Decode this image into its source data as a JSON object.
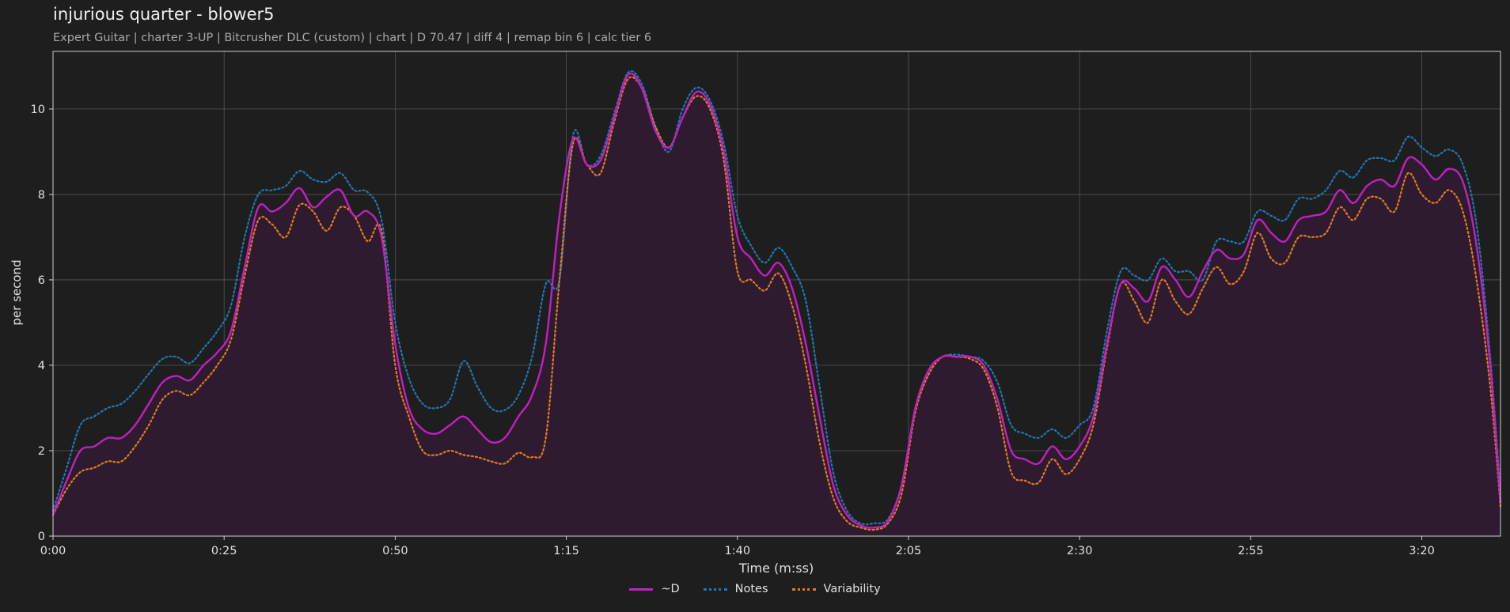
{
  "header": {
    "title": "injurious quarter - blower5",
    "subtitle": "Expert Guitar  |  charter 3-UP  |  Bitcrusher DLC (custom)  |  chart  |  D 70.47  |  diff 4  |  remap bin 6  |  calc tier 6"
  },
  "chart_data": {
    "type": "line",
    "xlabel": "Time (m:ss)",
    "ylabel": "per second",
    "xlim": [
      0,
      211.5
    ],
    "ylim": [
      0,
      11.35
    ],
    "x_ticks": [
      0,
      25,
      50,
      75,
      100,
      125,
      150,
      175,
      200
    ],
    "x_tick_labels": [
      "0:00",
      "0:25",
      "0:50",
      "1:15",
      "1:40",
      "2:05",
      "2:30",
      "2:55",
      "3:20"
    ],
    "y_ticks": [
      0,
      2,
      4,
      6,
      8,
      10
    ],
    "y_tick_labels": [
      "0",
      "2",
      "4",
      "6",
      "8",
      "10"
    ],
    "grid": true,
    "legend_position": "bottom-center",
    "series": [
      {
        "name": "~D",
        "color": "#c020c0",
        "dash": "solid",
        "fill": "#2f1b2f",
        "points": [
          [
            0,
            0.5
          ],
          [
            2,
            1.3
          ],
          [
            4,
            2.0
          ],
          [
            6,
            2.1
          ],
          [
            8,
            2.3
          ],
          [
            10,
            2.3
          ],
          [
            12,
            2.6
          ],
          [
            14,
            3.1
          ],
          [
            16,
            3.6
          ],
          [
            18,
            3.75
          ],
          [
            20,
            3.65
          ],
          [
            22,
            4.0
          ],
          [
            24,
            4.3
          ],
          [
            26,
            4.8
          ],
          [
            28,
            6.3
          ],
          [
            30,
            7.7
          ],
          [
            32,
            7.6
          ],
          [
            34,
            7.8
          ],
          [
            36,
            8.15
          ],
          [
            38,
            7.7
          ],
          [
            40,
            7.95
          ],
          [
            42,
            8.1
          ],
          [
            44,
            7.5
          ],
          [
            46,
            7.6
          ],
          [
            48,
            7.0
          ],
          [
            50,
            4.5
          ],
          [
            52,
            3.0
          ],
          [
            54,
            2.5
          ],
          [
            56,
            2.4
          ],
          [
            58,
            2.6
          ],
          [
            60,
            2.8
          ],
          [
            62,
            2.5
          ],
          [
            64,
            2.2
          ],
          [
            66,
            2.3
          ],
          [
            68,
            2.8
          ],
          [
            70,
            3.3
          ],
          [
            72,
            4.5
          ],
          [
            74,
            7.5
          ],
          [
            76,
            9.3
          ],
          [
            78,
            8.7
          ],
          [
            80,
            8.8
          ],
          [
            82,
            9.8
          ],
          [
            84,
            10.8
          ],
          [
            86,
            10.5
          ],
          [
            88,
            9.5
          ],
          [
            90,
            9.1
          ],
          [
            92,
            9.8
          ],
          [
            94,
            10.4
          ],
          [
            96,
            10.1
          ],
          [
            98,
            9.0
          ],
          [
            100,
            7.0
          ],
          [
            102,
            6.5
          ],
          [
            104,
            6.1
          ],
          [
            106,
            6.4
          ],
          [
            108,
            5.8
          ],
          [
            110,
            4.5
          ],
          [
            112,
            2.8
          ],
          [
            114,
            1.2
          ],
          [
            116,
            0.5
          ],
          [
            118,
            0.25
          ],
          [
            120,
            0.2
          ],
          [
            122,
            0.35
          ],
          [
            124,
            1.2
          ],
          [
            126,
            3.0
          ],
          [
            128,
            3.9
          ],
          [
            130,
            4.2
          ],
          [
            132,
            4.2
          ],
          [
            134,
            4.2
          ],
          [
            136,
            4.0
          ],
          [
            138,
            3.2
          ],
          [
            140,
            2.0
          ],
          [
            142,
            1.8
          ],
          [
            144,
            1.7
          ],
          [
            146,
            2.1
          ],
          [
            148,
            1.8
          ],
          [
            150,
            2.1
          ],
          [
            152,
            2.8
          ],
          [
            154,
            4.5
          ],
          [
            156,
            5.9
          ],
          [
            158,
            5.8
          ],
          [
            160,
            5.5
          ],
          [
            162,
            6.3
          ],
          [
            164,
            6.0
          ],
          [
            166,
            5.6
          ],
          [
            168,
            6.2
          ],
          [
            170,
            6.7
          ],
          [
            172,
            6.5
          ],
          [
            174,
            6.6
          ],
          [
            176,
            7.4
          ],
          [
            178,
            7.1
          ],
          [
            180,
            6.9
          ],
          [
            182,
            7.4
          ],
          [
            184,
            7.5
          ],
          [
            186,
            7.6
          ],
          [
            188,
            8.1
          ],
          [
            190,
            7.8
          ],
          [
            192,
            8.2
          ],
          [
            194,
            8.35
          ],
          [
            196,
            8.2
          ],
          [
            198,
            8.85
          ],
          [
            200,
            8.7
          ],
          [
            202,
            8.35
          ],
          [
            204,
            8.6
          ],
          [
            206,
            8.3
          ],
          [
            208,
            6.8
          ],
          [
            210,
            4.0
          ],
          [
            211.5,
            0.8
          ]
        ]
      },
      {
        "name": "Notes",
        "color": "#1f77b4",
        "dash": "dotted",
        "points": [
          [
            0,
            0.6
          ],
          [
            2,
            1.6
          ],
          [
            4,
            2.6
          ],
          [
            6,
            2.8
          ],
          [
            8,
            3.0
          ],
          [
            10,
            3.1
          ],
          [
            12,
            3.4
          ],
          [
            14,
            3.8
          ],
          [
            16,
            4.15
          ],
          [
            18,
            4.2
          ],
          [
            20,
            4.05
          ],
          [
            22,
            4.4
          ],
          [
            24,
            4.8
          ],
          [
            26,
            5.4
          ],
          [
            28,
            7.0
          ],
          [
            30,
            8.0
          ],
          [
            32,
            8.1
          ],
          [
            34,
            8.2
          ],
          [
            36,
            8.55
          ],
          [
            38,
            8.35
          ],
          [
            40,
            8.3
          ],
          [
            42,
            8.5
          ],
          [
            44,
            8.1
          ],
          [
            46,
            8.05
          ],
          [
            48,
            7.4
          ],
          [
            50,
            5.0
          ],
          [
            52,
            3.7
          ],
          [
            54,
            3.1
          ],
          [
            56,
            3.0
          ],
          [
            58,
            3.2
          ],
          [
            60,
            4.1
          ],
          [
            62,
            3.5
          ],
          [
            64,
            3.0
          ],
          [
            66,
            2.95
          ],
          [
            68,
            3.3
          ],
          [
            70,
            4.2
          ],
          [
            72,
            5.9
          ],
          [
            74,
            6.0
          ],
          [
            76,
            9.4
          ],
          [
            78,
            8.7
          ],
          [
            80,
            8.9
          ],
          [
            82,
            9.9
          ],
          [
            84,
            10.85
          ],
          [
            86,
            10.6
          ],
          [
            88,
            9.6
          ],
          [
            90,
            9.0
          ],
          [
            92,
            10.0
          ],
          [
            94,
            10.5
          ],
          [
            96,
            10.2
          ],
          [
            98,
            9.2
          ],
          [
            100,
            7.5
          ],
          [
            102,
            6.8
          ],
          [
            104,
            6.4
          ],
          [
            106,
            6.75
          ],
          [
            108,
            6.3
          ],
          [
            110,
            5.5
          ],
          [
            112,
            3.5
          ],
          [
            114,
            1.5
          ],
          [
            116,
            0.6
          ],
          [
            118,
            0.3
          ],
          [
            120,
            0.3
          ],
          [
            122,
            0.4
          ],
          [
            124,
            1.2
          ],
          [
            126,
            3.0
          ],
          [
            128,
            3.9
          ],
          [
            130,
            4.2
          ],
          [
            132,
            4.25
          ],
          [
            134,
            4.2
          ],
          [
            136,
            4.1
          ],
          [
            138,
            3.6
          ],
          [
            140,
            2.6
          ],
          [
            142,
            2.4
          ],
          [
            144,
            2.3
          ],
          [
            146,
            2.5
          ],
          [
            148,
            2.3
          ],
          [
            150,
            2.6
          ],
          [
            152,
            3.0
          ],
          [
            154,
            4.8
          ],
          [
            156,
            6.2
          ],
          [
            158,
            6.1
          ],
          [
            160,
            6.0
          ],
          [
            162,
            6.5
          ],
          [
            164,
            6.2
          ],
          [
            166,
            6.2
          ],
          [
            168,
            6.0
          ],
          [
            170,
            6.9
          ],
          [
            172,
            6.9
          ],
          [
            174,
            6.9
          ],
          [
            176,
            7.6
          ],
          [
            178,
            7.5
          ],
          [
            180,
            7.4
          ],
          [
            182,
            7.9
          ],
          [
            184,
            7.9
          ],
          [
            186,
            8.1
          ],
          [
            188,
            8.55
          ],
          [
            190,
            8.4
          ],
          [
            192,
            8.8
          ],
          [
            194,
            8.85
          ],
          [
            196,
            8.8
          ],
          [
            198,
            9.35
          ],
          [
            200,
            9.1
          ],
          [
            202,
            8.9
          ],
          [
            204,
            9.05
          ],
          [
            206,
            8.7
          ],
          [
            208,
            7.3
          ],
          [
            210,
            4.2
          ],
          [
            211.5,
            1.0
          ]
        ]
      },
      {
        "name": "Variability",
        "color": "#e07b20",
        "dash": "dotted",
        "points": [
          [
            0,
            0.5
          ],
          [
            2,
            1.1
          ],
          [
            4,
            1.5
          ],
          [
            6,
            1.6
          ],
          [
            8,
            1.75
          ],
          [
            10,
            1.75
          ],
          [
            12,
            2.1
          ],
          [
            14,
            2.6
          ],
          [
            16,
            3.2
          ],
          [
            18,
            3.4
          ],
          [
            20,
            3.3
          ],
          [
            22,
            3.6
          ],
          [
            24,
            4.0
          ],
          [
            26,
            4.6
          ],
          [
            28,
            6.1
          ],
          [
            30,
            7.4
          ],
          [
            32,
            7.3
          ],
          [
            34,
            7.0
          ],
          [
            36,
            7.75
          ],
          [
            38,
            7.6
          ],
          [
            40,
            7.15
          ],
          [
            42,
            7.7
          ],
          [
            44,
            7.5
          ],
          [
            46,
            6.9
          ],
          [
            48,
            7.15
          ],
          [
            50,
            4.0
          ],
          [
            52,
            2.8
          ],
          [
            54,
            2.0
          ],
          [
            56,
            1.9
          ],
          [
            58,
            2.0
          ],
          [
            60,
            1.9
          ],
          [
            62,
            1.85
          ],
          [
            64,
            1.75
          ],
          [
            66,
            1.7
          ],
          [
            68,
            1.95
          ],
          [
            70,
            1.85
          ],
          [
            72,
            2.3
          ],
          [
            74,
            6.0
          ],
          [
            76,
            9.2
          ],
          [
            78,
            8.7
          ],
          [
            80,
            8.5
          ],
          [
            82,
            9.7
          ],
          [
            84,
            10.7
          ],
          [
            86,
            10.5
          ],
          [
            88,
            9.6
          ],
          [
            90,
            9.1
          ],
          [
            92,
            9.8
          ],
          [
            94,
            10.3
          ],
          [
            96,
            10.0
          ],
          [
            98,
            8.8
          ],
          [
            100,
            6.2
          ],
          [
            102,
            6.0
          ],
          [
            104,
            5.75
          ],
          [
            106,
            6.15
          ],
          [
            108,
            5.4
          ],
          [
            110,
            4.0
          ],
          [
            112,
            2.2
          ],
          [
            114,
            0.9
          ],
          [
            116,
            0.35
          ],
          [
            118,
            0.2
          ],
          [
            120,
            0.15
          ],
          [
            122,
            0.3
          ],
          [
            124,
            1.0
          ],
          [
            126,
            2.9
          ],
          [
            128,
            3.8
          ],
          [
            130,
            4.2
          ],
          [
            132,
            4.2
          ],
          [
            134,
            4.15
          ],
          [
            136,
            3.9
          ],
          [
            138,
            3.0
          ],
          [
            140,
            1.5
          ],
          [
            142,
            1.3
          ],
          [
            144,
            1.25
          ],
          [
            146,
            1.8
          ],
          [
            148,
            1.45
          ],
          [
            150,
            1.8
          ],
          [
            152,
            2.6
          ],
          [
            154,
            4.4
          ],
          [
            156,
            5.9
          ],
          [
            158,
            5.5
          ],
          [
            160,
            5.0
          ],
          [
            162,
            6.0
          ],
          [
            164,
            5.5
          ],
          [
            166,
            5.2
          ],
          [
            168,
            5.8
          ],
          [
            170,
            6.3
          ],
          [
            172,
            5.9
          ],
          [
            174,
            6.2
          ],
          [
            176,
            7.1
          ],
          [
            178,
            6.5
          ],
          [
            180,
            6.4
          ],
          [
            182,
            7.0
          ],
          [
            184,
            7.0
          ],
          [
            186,
            7.1
          ],
          [
            188,
            7.7
          ],
          [
            190,
            7.4
          ],
          [
            192,
            7.9
          ],
          [
            194,
            7.9
          ],
          [
            196,
            7.6
          ],
          [
            198,
            8.5
          ],
          [
            200,
            8.0
          ],
          [
            202,
            7.8
          ],
          [
            204,
            8.1
          ],
          [
            206,
            7.6
          ],
          [
            208,
            6.0
          ],
          [
            210,
            3.5
          ],
          [
            211.5,
            0.7
          ]
        ]
      }
    ]
  }
}
